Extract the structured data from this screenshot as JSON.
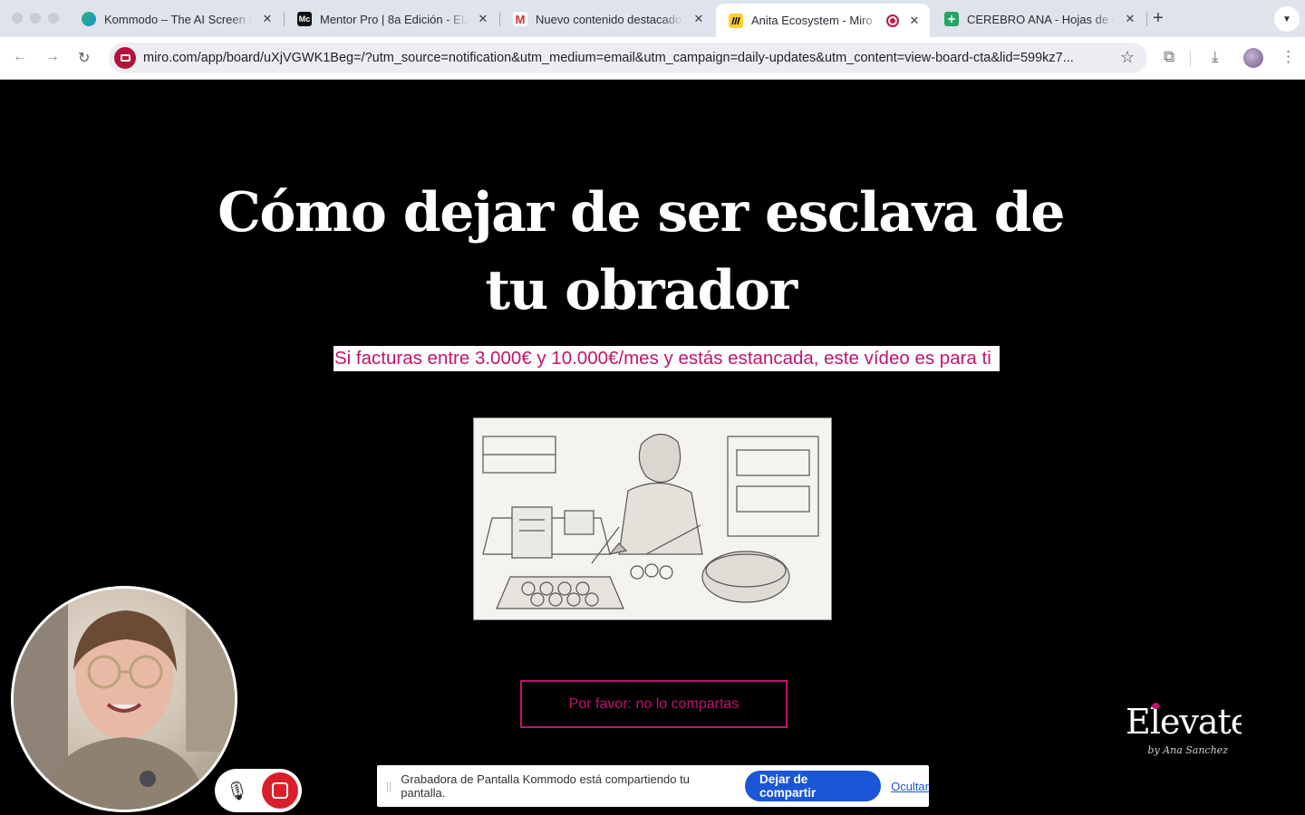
{
  "browser": {
    "tabs": [
      {
        "title": "Kommodo – The AI Screen Re",
        "favicon": "kommodo-icon",
        "active": false
      },
      {
        "title": "Mentor Pro | 8a Edición - ELE",
        "favicon": "mentor-icon",
        "favicon_text": "Mc",
        "active": false
      },
      {
        "title": "Nuevo contenido destacado e",
        "favicon": "gmail-icon",
        "favicon_text": "M",
        "active": false
      },
      {
        "title": "Anita Ecosystem - Miro",
        "favicon": "miro-icon",
        "active": true
      },
      {
        "title": "CEREBRO ANA - Hojas de cá",
        "favicon": "sheets-icon",
        "active": false
      }
    ],
    "address": "miro.com/app/board/uXjVGWK1Beg=/?utm_source=notification&utm_medium=email&utm_campaign=daily-updates&utm_content=view-board-cta&lid=599kz7..."
  },
  "page": {
    "headline": "Cómo dejar de ser esclava de tu obrador",
    "subheadline": "Si facturas entre 3.000€ y 10.000€/mes y estás estancada, este vídeo es para ti",
    "cta_label": "Por favor: no lo compartas",
    "logo_word": "Elevate",
    "logo_byline": "by Ana Sanchez"
  },
  "sharing_bar": {
    "message": "Grabadora de Pantalla Kommodo está compartiendo tu pantalla.",
    "stop_label": "Dejar de compartir",
    "hide_label": "Ocultar"
  },
  "colors": {
    "accent_pink": "#c2136f",
    "share_blue": "#1a56d6",
    "record_red": "#d9202a"
  }
}
